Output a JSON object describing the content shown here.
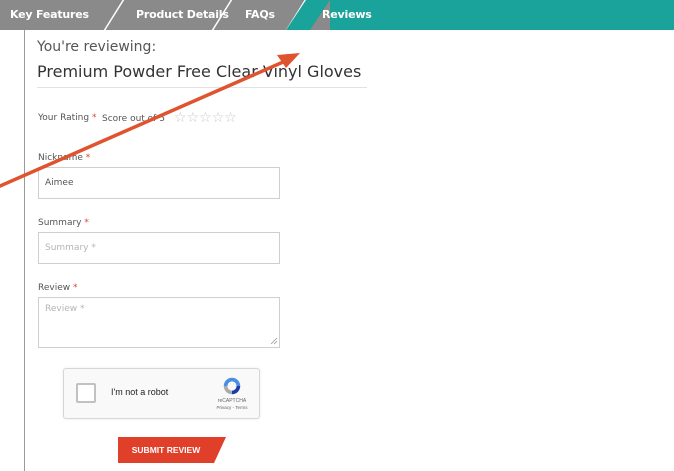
{
  "tabs": [
    {
      "label": "Key Features",
      "active": false
    },
    {
      "label": "Product Details",
      "active": false
    },
    {
      "label": "FAQs",
      "active": false
    },
    {
      "label": "Reviews",
      "active": true
    }
  ],
  "review": {
    "subheading": "You're reviewing:",
    "product_name": "Premium Powder Free Clear Vinyl Gloves",
    "rating_label": "Your Rating",
    "required_mark": "*",
    "score_text": "Score out of 5",
    "stars": [
      "☆",
      "☆",
      "☆",
      "☆",
      "☆"
    ],
    "nickname_label": "Nickname",
    "nickname_value": "Aimee",
    "summary_label": "Summary",
    "summary_placeholder": "Summary *",
    "review_label": "Review",
    "review_placeholder": "Review *"
  },
  "captcha": {
    "label": "I'm not a robot",
    "brand": "reCAPTCHA",
    "links": "Privacy - Terms"
  },
  "submit_label": "SUBMIT REVIEW",
  "colors": {
    "tabbar_active": "#1aa39a",
    "tabbar_inactive": "#8a8a8a",
    "required": "#e0402a",
    "submit": "#e0402a",
    "annotation_arrow": "#e0532f"
  },
  "annotation": {
    "type": "arrow",
    "target": "tab-reviews"
  }
}
